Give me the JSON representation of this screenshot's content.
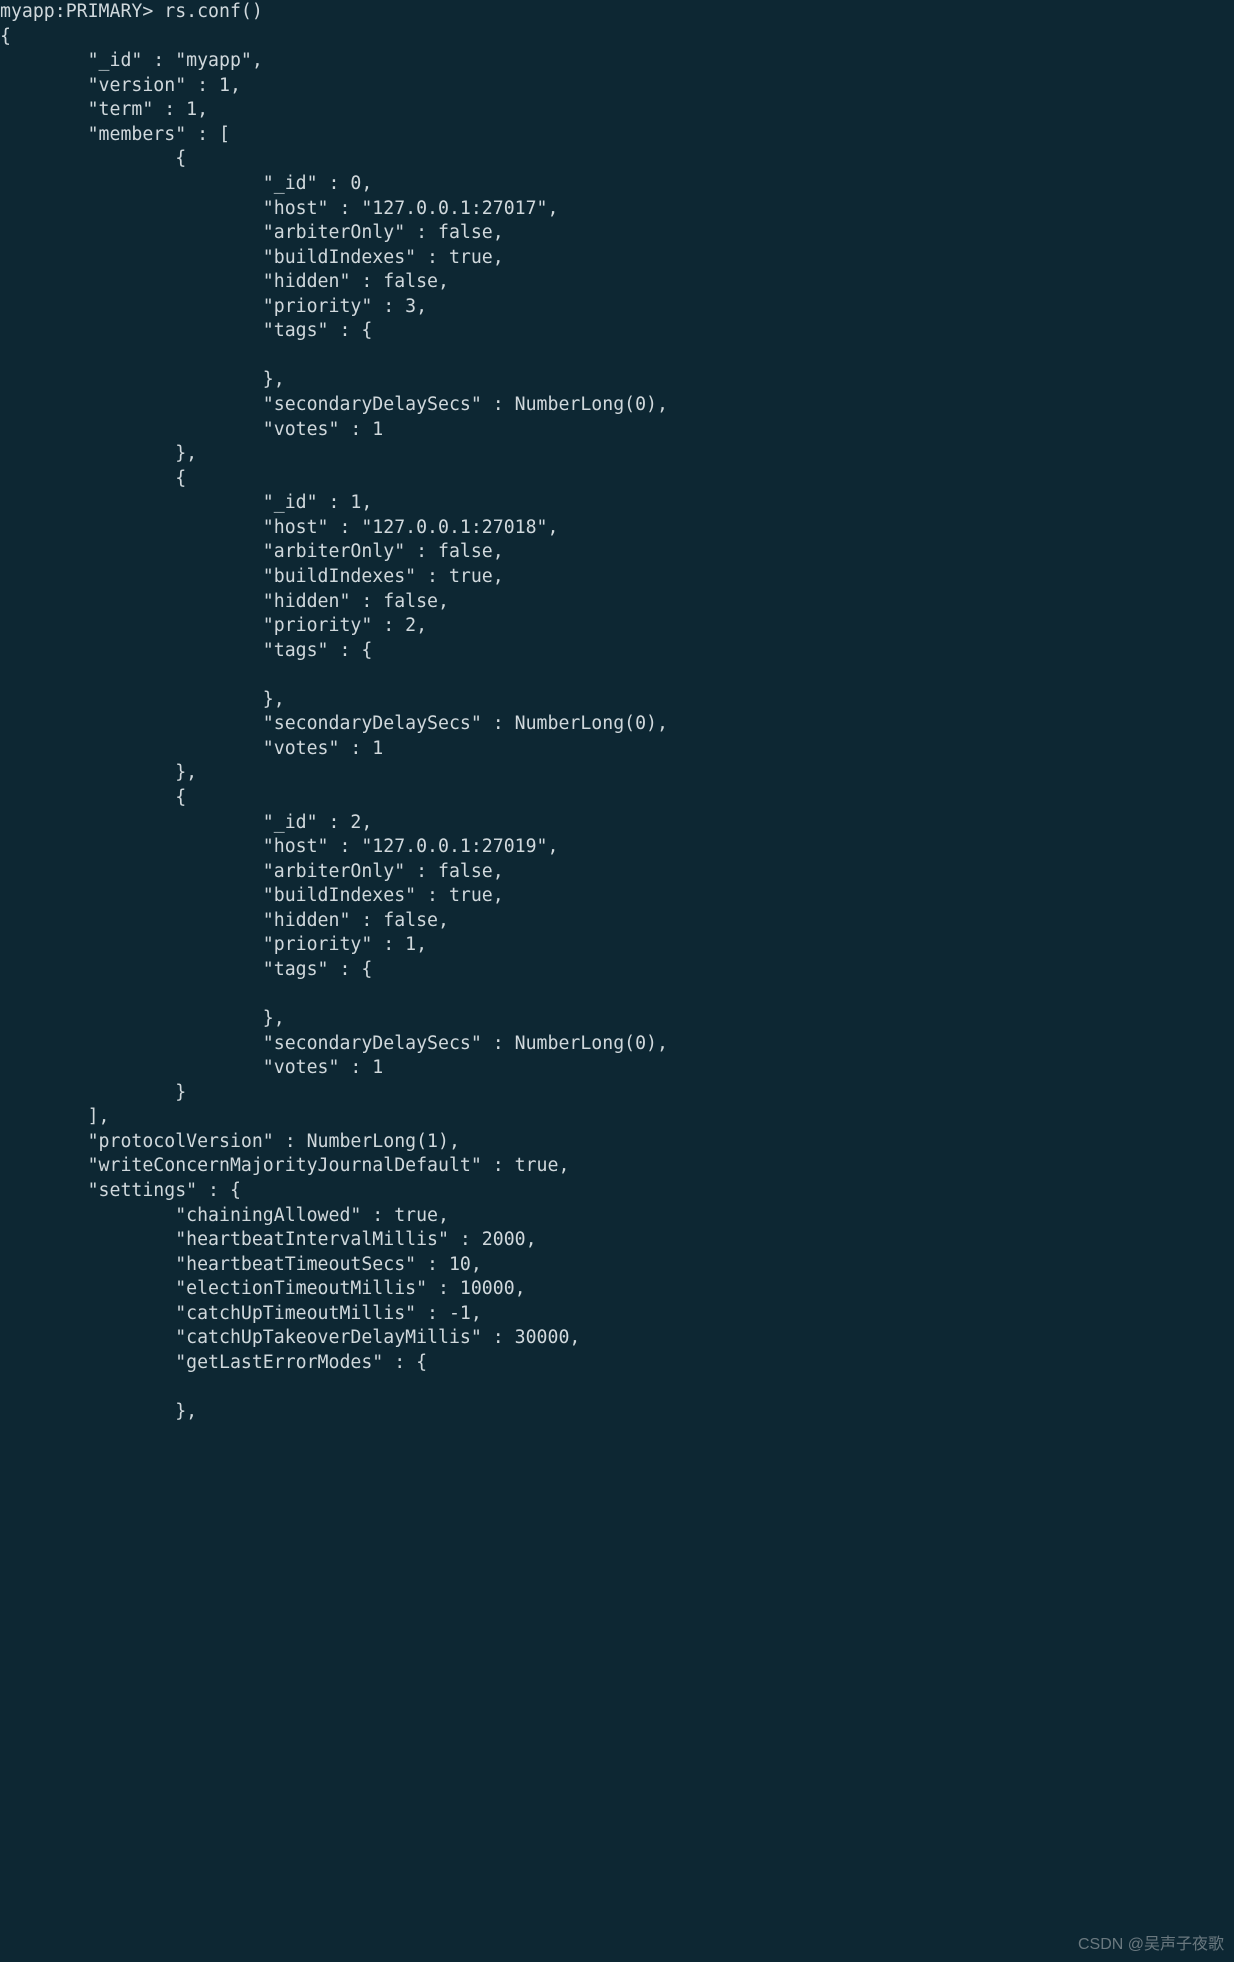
{
  "prompt": "myapp:PRIMARY> rs.conf()",
  "conf": {
    "_id": "\"myapp\"",
    "version": "1",
    "term": "1",
    "members": [
      {
        "_id": "0",
        "host": "\"127.0.0.1:27017\"",
        "arbiterOnly": "false",
        "buildIndexes": "true",
        "hidden": "false",
        "priority": "3",
        "secondaryDelaySecs": "NumberLong(0)",
        "votes": "1"
      },
      {
        "_id": "1",
        "host": "\"127.0.0.1:27018\"",
        "arbiterOnly": "false",
        "buildIndexes": "true",
        "hidden": "false",
        "priority": "2",
        "secondaryDelaySecs": "NumberLong(0)",
        "votes": "1"
      },
      {
        "_id": "2",
        "host": "\"127.0.0.1:27019\"",
        "arbiterOnly": "false",
        "buildIndexes": "true",
        "hidden": "false",
        "priority": "1",
        "secondaryDelaySecs": "NumberLong(0)",
        "votes": "1"
      }
    ],
    "protocolVersion": "NumberLong(1)",
    "writeConcernMajorityJournalDefault": "true",
    "settings": {
      "chainingAllowed": "true",
      "heartbeatIntervalMillis": "2000",
      "heartbeatTimeoutSecs": "10",
      "electionTimeoutMillis": "10000",
      "catchUpTimeoutMillis": "-1",
      "catchUpTakeoverDelayMillis": "30000"
    }
  },
  "watermark": "CSDN @吴声子夜歌"
}
